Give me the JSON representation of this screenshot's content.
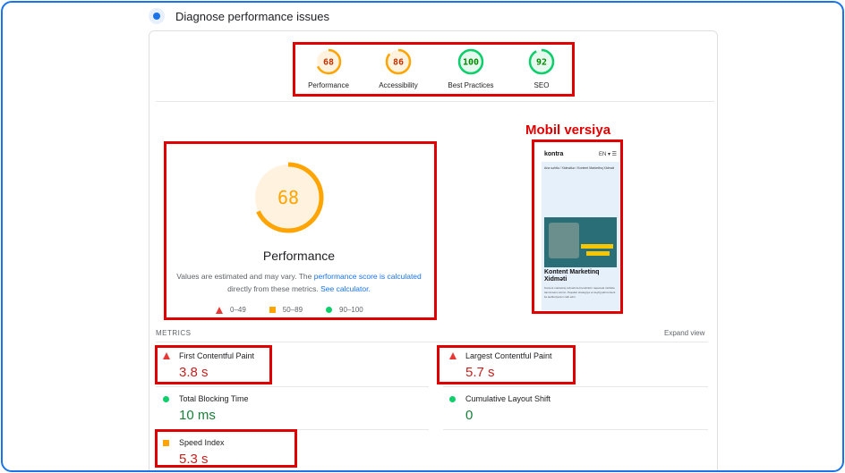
{
  "header": {
    "title": "Diagnose performance issues"
  },
  "gauges": [
    {
      "score": "68",
      "label": "Performance",
      "value": 68,
      "color": "#ffa400",
      "text_color": "#c33300",
      "fill": "#fff3e0"
    },
    {
      "score": "86",
      "label": "Accessibility",
      "value": 86,
      "color": "#ffa400",
      "text_color": "#c33300",
      "fill": "#fff3e0"
    },
    {
      "score": "100",
      "label": "Best Practices",
      "value": 100,
      "color": "#0cce6b",
      "text_color": "#008800",
      "fill": "#e6f9ee"
    },
    {
      "score": "92",
      "label": "SEO",
      "value": 92,
      "color": "#0cce6b",
      "text_color": "#008800",
      "fill": "#e6f9ee"
    }
  ],
  "performance": {
    "score": "68",
    "value": 68,
    "title": "Performance",
    "desc_1": "Values are estimated and may vary. The ",
    "desc_link_1": "performance score is calculated",
    "desc_2": " directly from these metrics. ",
    "desc_link_2": "See calculator."
  },
  "legend": {
    "low": "0–49",
    "mid": "50–89",
    "high": "90–100"
  },
  "annotation": {
    "mobile_label": "Mobil versiya"
  },
  "phone": {
    "logo": "kontra",
    "lang": "EN ▾ ☰",
    "crumb": "Ana səhifə / Xidmətlər / Kontent Marketinq Xidməti",
    "heading": "Kontent Marketinq Xidməti",
    "text": "Kontent marketinq xidməti ilə brendinizin rəqəmsal mühitdə tanınmasını artırın. Peşəkar strategiya və keyfiyyətli kontent ilə auditoriyanızı cəlb edin."
  },
  "metrics": {
    "title": "METRICS",
    "expand": "Expand view",
    "items": [
      {
        "name": "First Contentful Paint",
        "value": "3.8 s",
        "status": "red"
      },
      {
        "name": "Largest Contentful Paint",
        "value": "5.7 s",
        "status": "red"
      },
      {
        "name": "Total Blocking Time",
        "value": "10 ms",
        "status": "green"
      },
      {
        "name": "Cumulative Layout Shift",
        "value": "0",
        "status": "green"
      },
      {
        "name": "Speed Index",
        "value": "5.3 s",
        "status": "orange"
      }
    ]
  },
  "colors": {
    "annotation_red": "#e00000",
    "frame_blue": "#1a73e8",
    "link_blue": "#1a73e8"
  }
}
